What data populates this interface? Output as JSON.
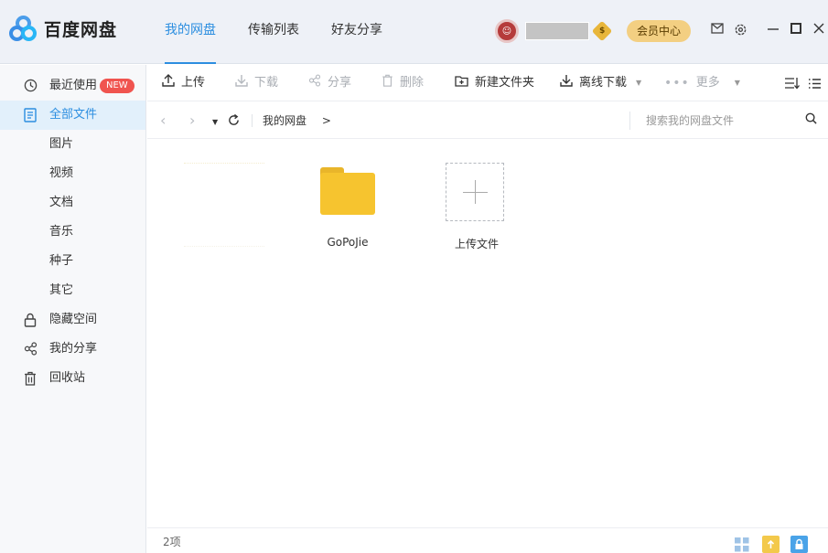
{
  "app": {
    "name": "百度网盘"
  },
  "tabs": [
    {
      "label": "我的网盘",
      "active": true
    },
    {
      "label": "传输列表",
      "active": false
    },
    {
      "label": "好友分享",
      "active": false
    }
  ],
  "user": {
    "coin_symbol": "$",
    "vip_label": "会员中心"
  },
  "titlebar_icons": [
    "mail-icon",
    "settings-icon",
    "minimize-icon",
    "maximize-icon",
    "close-icon"
  ],
  "sidebar": {
    "items": [
      {
        "label": "最近使用",
        "icon": "clock-icon",
        "badge": "NEW"
      },
      {
        "label": "全部文件",
        "icon": "file-list-icon",
        "active": true
      },
      {
        "label": "图片"
      },
      {
        "label": "视频"
      },
      {
        "label": "文档"
      },
      {
        "label": "音乐"
      },
      {
        "label": "种子"
      },
      {
        "label": "其它"
      },
      {
        "label": "隐藏空间",
        "icon": "lock-icon"
      },
      {
        "label": "我的分享",
        "icon": "share-icon"
      },
      {
        "label": "回收站",
        "icon": "trash-icon"
      }
    ]
  },
  "toolbar": {
    "upload": "上传",
    "download": "下载",
    "share": "分享",
    "delete": "删除",
    "new_folder": "新建文件夹",
    "offline_download": "离线下载",
    "more": "更多"
  },
  "address": {
    "breadcrumb": "我的网盘",
    "separator": ">",
    "search_placeholder": "搜索我的网盘文件"
  },
  "files": [
    {
      "name": "GoPoJie",
      "type": "folder"
    },
    {
      "name": "上传文件",
      "type": "upload"
    }
  ],
  "status": {
    "count": "2项"
  },
  "colors": {
    "accent": "#2c8ee0",
    "folder": "#f6c42f",
    "badge": "#f0544f",
    "vip": "#f3cf82"
  }
}
